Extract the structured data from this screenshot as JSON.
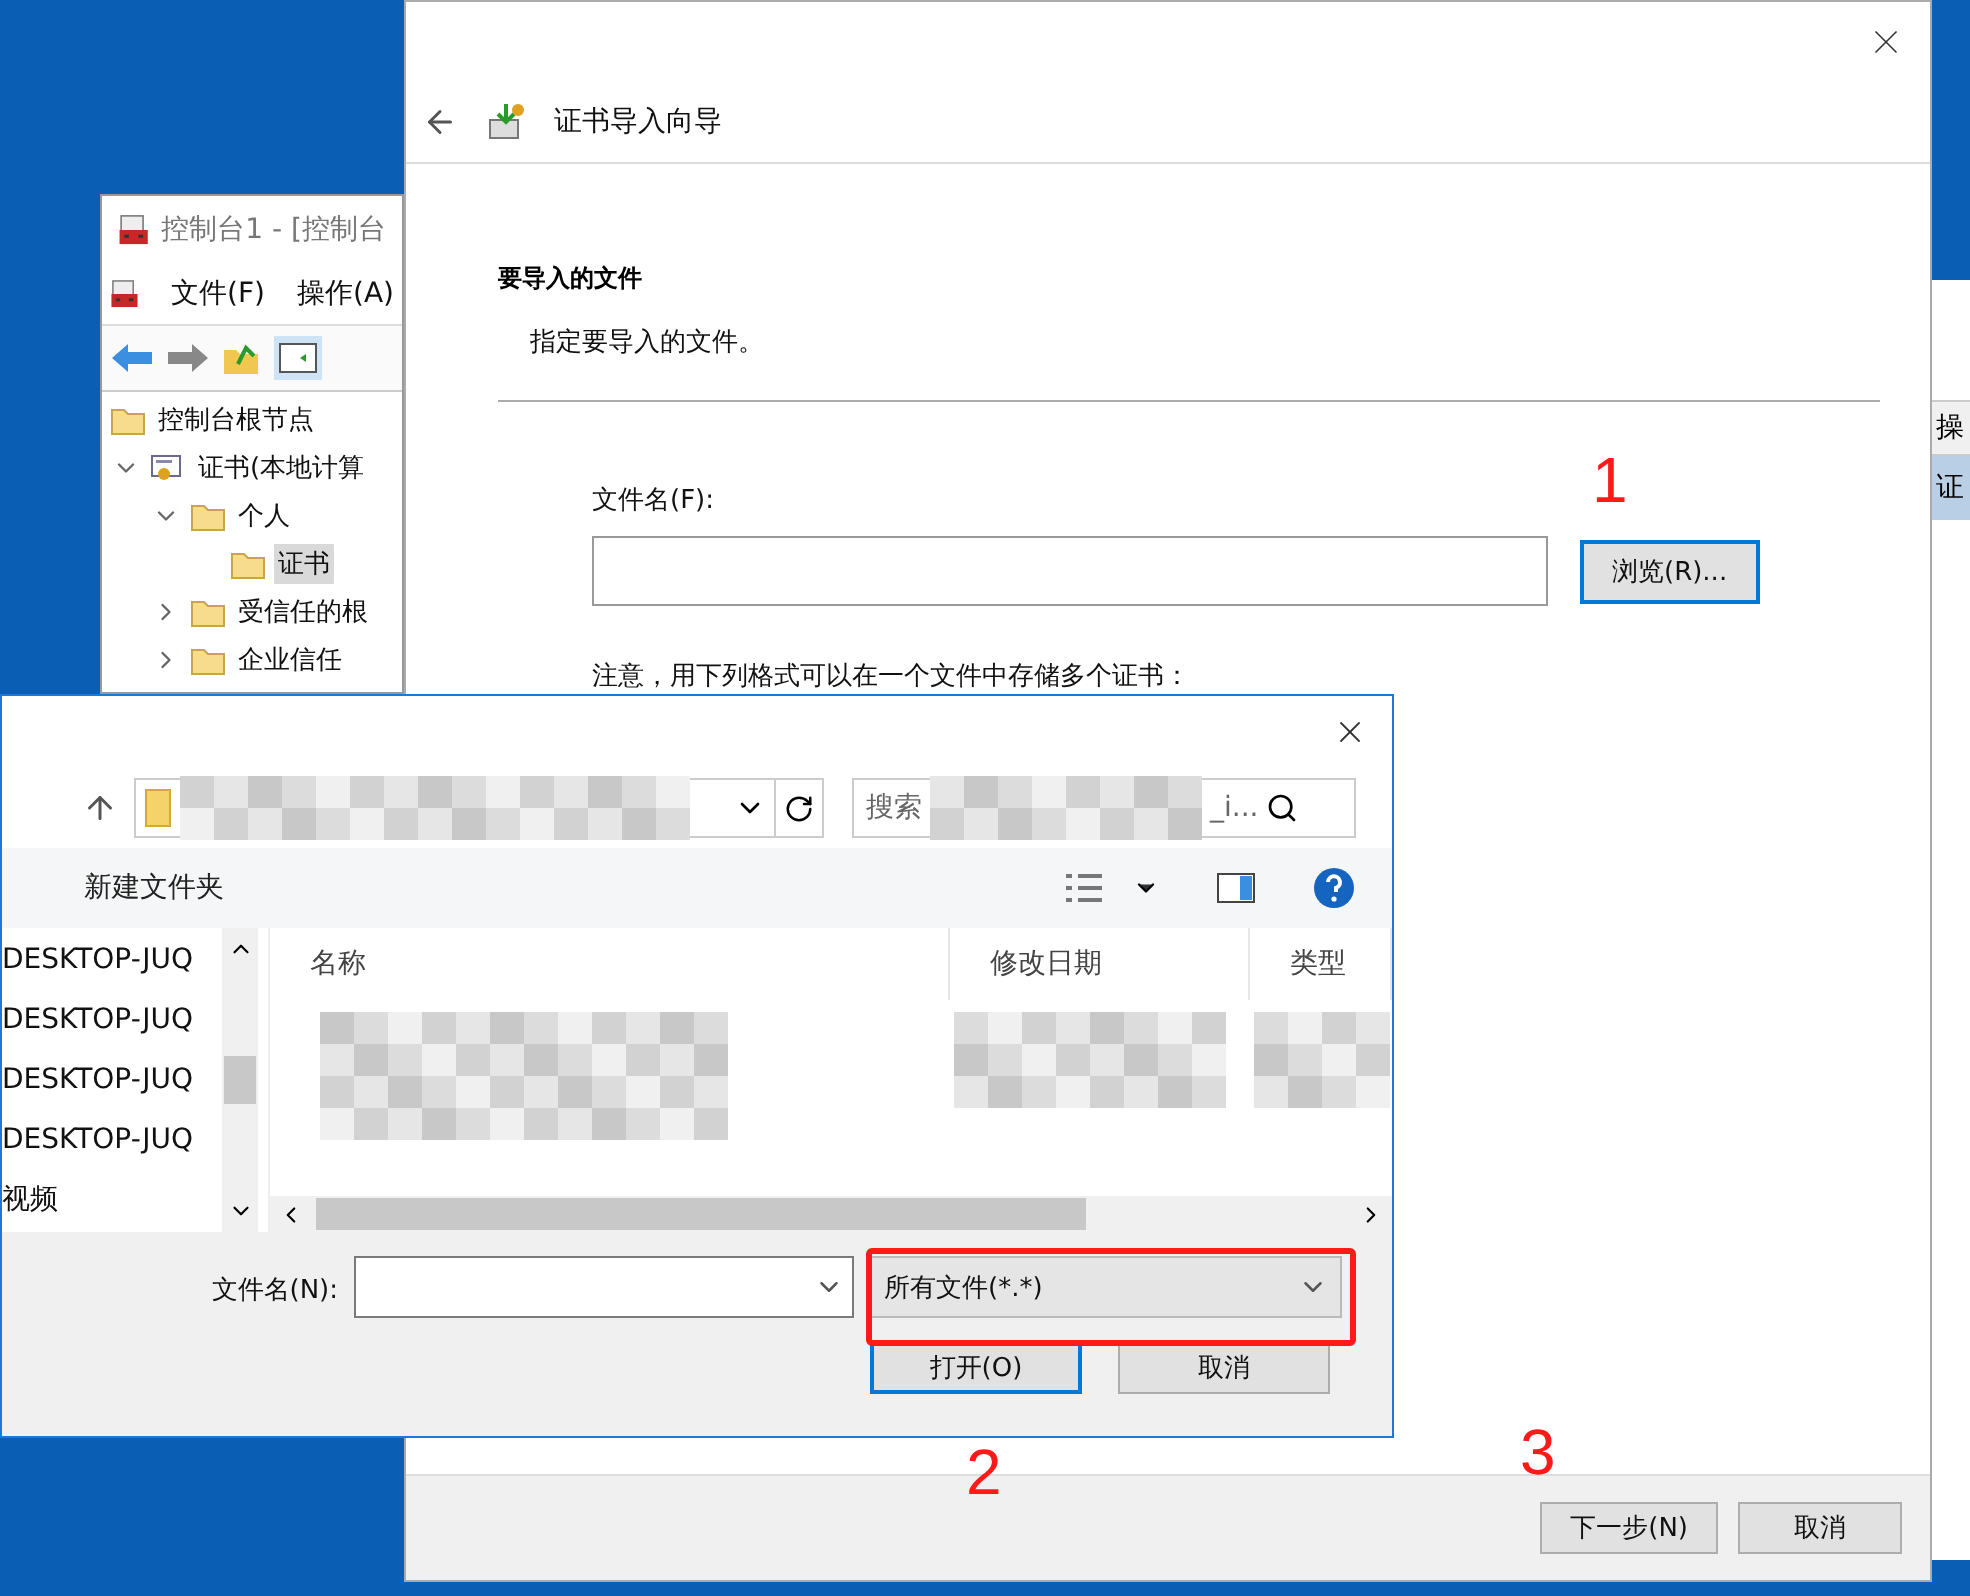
{
  "console_window": {
    "title": "控制台1 - [控制台",
    "menu": [
      "文件(F)",
      "操作(A)"
    ],
    "tree": [
      {
        "label": "控制台根节点",
        "kind": "folder",
        "selected": false,
        "children": [
          {
            "label": "证书(本地计算",
            "kind": "certificate",
            "selected": false,
            "expanded": true,
            "children": [
              {
                "label": "个人",
                "kind": "folder",
                "selected": false,
                "expanded": true,
                "children": [
                  {
                    "label": "证书",
                    "kind": "folder",
                    "selected": true
                  }
                ]
              },
              {
                "label": "受信任的根",
                "kind": "folder",
                "selected": false,
                "expanded": false
              },
              {
                "label": "企业信任",
                "kind": "folder",
                "selected": false,
                "expanded": false
              }
            ]
          }
        ]
      }
    ]
  },
  "side_window": {
    "header": "操",
    "rows": [
      {
        "label": "证",
        "selected": true
      }
    ]
  },
  "wizard": {
    "title": "证书导入向导",
    "section_title": "要导入的文件",
    "section_subtitle": "指定要导入的文件。",
    "file_label": "文件名(F):",
    "browse_button": {
      "label": "浏览(R)...",
      "focused": true
    },
    "note": "注意，用下列格式可以在一个文件中存储多个证书：",
    "buttons": [
      {
        "label": "下一步(N)",
        "focused": false
      },
      {
        "label": "取消",
        "focused": false
      }
    ]
  },
  "file_dialog": {
    "search_placeholder": "搜索",
    "search_suffix": "_i...",
    "new_folder": "新建文件夹",
    "nav_items": [
      "DESKTOP-JUQ",
      "DESKTOP-JUQ",
      "DESKTOP-JUQ",
      "DESKTOP-JUQ",
      "视频"
    ],
    "columns": [
      "名称",
      "修改日期",
      "类型"
    ],
    "file_name_label": "文件名(N):",
    "file_type": "所有文件(*.*)",
    "buttons": [
      {
        "label": "打开(O)",
        "focused": true
      },
      {
        "label": "取消",
        "focused": false
      }
    ]
  },
  "annotations": [
    {
      "label": "1"
    },
    {
      "label": "2"
    },
    {
      "label": "3"
    }
  ]
}
